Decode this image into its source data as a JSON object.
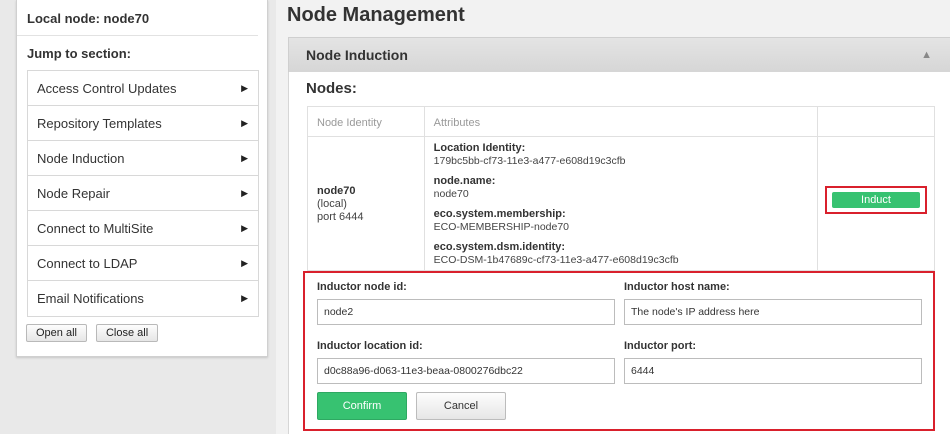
{
  "sidebar": {
    "local_node": "Local node: node70",
    "jump_label": "Jump to section:",
    "items": [
      {
        "label": "Access Control Updates"
      },
      {
        "label": "Repository Templates"
      },
      {
        "label": "Node Induction"
      },
      {
        "label": "Node Repair"
      },
      {
        "label": "Connect to MultiSite"
      },
      {
        "label": "Connect to LDAP"
      },
      {
        "label": "Email Notifications"
      }
    ],
    "open_all": "Open all",
    "close_all": "Close all"
  },
  "main": {
    "title": "Node Management",
    "section_title": "Node Induction",
    "nodes_title": "Nodes:",
    "table": {
      "headers": [
        "Node Identity",
        "Attributes",
        ""
      ],
      "row": {
        "node_name": "node70",
        "node_local": "(local)",
        "node_port": "port 6444",
        "attributes": [
          {
            "label": "Location Identity:",
            "value": "179bc5bb-cf73-11e3-a477-e608d19c3cfb"
          },
          {
            "label": "node.name:",
            "value": "node70"
          },
          {
            "label": "eco.system.membership:",
            "value": "ECO-MEMBERSHIP-node70"
          },
          {
            "label": "eco.system.dsm.identity:",
            "value": "ECO-DSM-1b47689c-cf73-11e3-a477-e608d19c3cfb"
          }
        ],
        "induct_label": "Induct"
      }
    },
    "form": {
      "node_id_label": "Inductor node id:",
      "node_id_value": "node2",
      "host_label": "Inductor host name:",
      "host_value": "The node's IP address here",
      "location_label": "Inductor location id:",
      "location_value": "d0c88a96-d063-11e3-beaa-0800276dbc22",
      "port_label": "Inductor port:",
      "port_value": "6444",
      "confirm_label": "Confirm",
      "cancel_label": "Cancel"
    }
  },
  "colors": {
    "accent_green": "#37c271",
    "highlight_red": "#d9202c"
  }
}
